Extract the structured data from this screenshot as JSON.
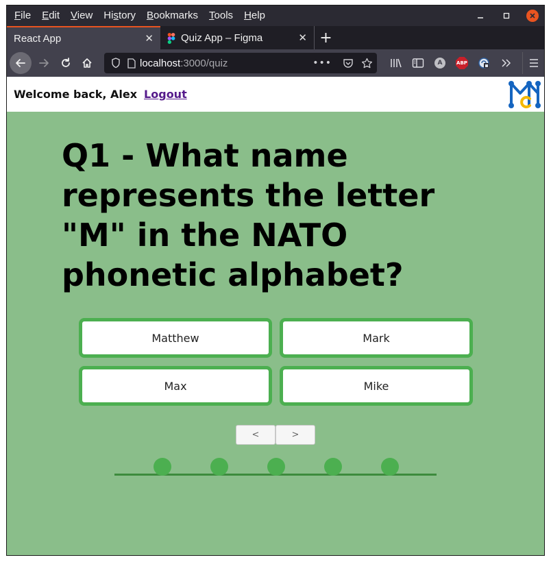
{
  "menu": {
    "items": [
      {
        "label": "File",
        "accel": "F",
        "rest": "ile"
      },
      {
        "label": "Edit",
        "accel": "E",
        "rest": "dit"
      },
      {
        "label": "View",
        "accel": "V",
        "rest": "iew"
      },
      {
        "label": "History",
        "pre": "Hi",
        "accel": "s",
        "rest": "tory"
      },
      {
        "label": "Bookmarks",
        "accel": "B",
        "rest": "ookmarks"
      },
      {
        "label": "Tools",
        "accel": "T",
        "rest": "ools"
      },
      {
        "label": "Help",
        "accel": "H",
        "rest": "elp"
      }
    ]
  },
  "tabs": [
    {
      "title": "React App",
      "active": true
    },
    {
      "title": "Quiz App – Figma",
      "active": false
    }
  ],
  "urlbar": {
    "host": "localhost",
    "path": ":3000/quiz"
  },
  "icons": {
    "back": "back-arrow-icon",
    "forward": "forward-arrow-icon",
    "reload": "reload-icon",
    "home": "home-icon",
    "shield": "tracking-shield-icon",
    "page": "page-info-icon",
    "more": "page-actions-icon",
    "pocket": "pocket-icon",
    "star": "bookmark-star-icon",
    "library": "library-icon",
    "reader": "sidebar-icon",
    "account": "account-icon",
    "adblock": "adblock-plus-icon",
    "extension": "extension-icon",
    "overflow": "overflow-chevron-icon",
    "menu": "hamburger-menu-icon"
  },
  "extensions": {
    "account_letter": "A",
    "adblock_text": "ABP"
  },
  "header": {
    "welcome": "Welcome back, Alex",
    "logout": "Logout"
  },
  "quiz": {
    "question": "Q1 - What name represents the letter \"M\" in the NATO phonetic alphabet?",
    "answers": [
      "Matthew",
      "Mark",
      "Max",
      "Mike"
    ],
    "prev_label": "<",
    "next_label": ">",
    "progress_steps": 5
  },
  "colors": {
    "page_bg": "#8abe8a",
    "accent": "#4caf50",
    "progress_line": "#3d8b3d",
    "logout_link": "#551a8b",
    "browser_close": "#e95420"
  }
}
